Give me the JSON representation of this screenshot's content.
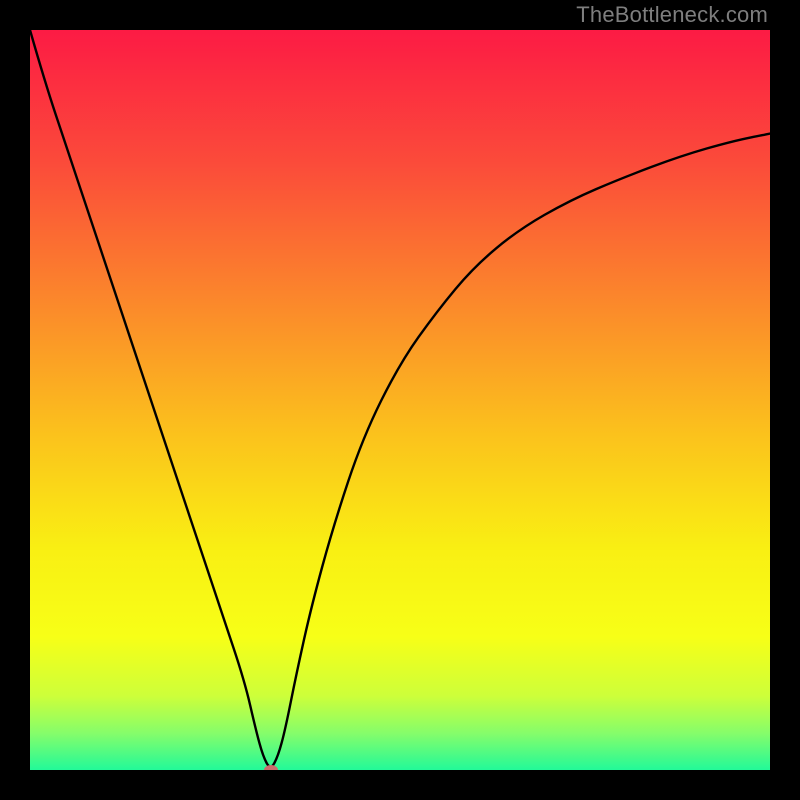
{
  "watermark": "TheBottleneck.com",
  "chart_data": {
    "type": "line",
    "title": "",
    "xlabel": "",
    "ylabel": "",
    "xlim": [
      0,
      100
    ],
    "ylim": [
      0,
      100
    ],
    "x_min_percent": 32.5,
    "gradient_stops": [
      {
        "offset": 0.0,
        "color": "#fc1b44"
      },
      {
        "offset": 0.18,
        "color": "#fb4b3a"
      },
      {
        "offset": 0.38,
        "color": "#fb8c2a"
      },
      {
        "offset": 0.55,
        "color": "#fbc31c"
      },
      {
        "offset": 0.7,
        "color": "#f9ef13"
      },
      {
        "offset": 0.82,
        "color": "#f7ff17"
      },
      {
        "offset": 0.9,
        "color": "#cdff3a"
      },
      {
        "offset": 0.95,
        "color": "#86fd6a"
      },
      {
        "offset": 1.0,
        "color": "#22f999"
      }
    ],
    "series": [
      {
        "name": "bottleneck-curve",
        "x": [
          0,
          2,
          5,
          8,
          11,
          14,
          17,
          20,
          23,
          26,
          29,
          30.5,
          31.5,
          32.5,
          33.5,
          34.5,
          36,
          38,
          41,
          45,
          50,
          55,
          60,
          66,
          73,
          80,
          88,
          95,
          100
        ],
        "values": [
          100,
          93,
          84,
          75,
          66,
          57,
          48,
          39,
          30,
          21,
          12,
          5.5,
          1.8,
          0,
          1.8,
          5.5,
          13,
          22,
          33,
          45,
          55,
          62,
          68,
          73,
          77,
          80,
          83,
          85,
          86
        ]
      }
    ],
    "marker": {
      "x_percent": 32.5,
      "y_percent": 0
    }
  }
}
